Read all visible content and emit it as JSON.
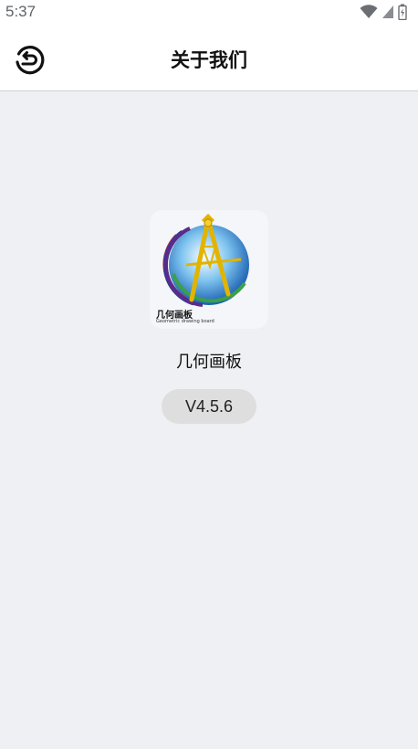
{
  "status_bar": {
    "time": "5:37",
    "icons": [
      "wifi-icon",
      "cell-signal-icon",
      "battery-icon"
    ]
  },
  "header": {
    "back_icon": "back-arrow-icon",
    "title": "关于我们"
  },
  "app": {
    "logo_text": "几何画板",
    "logo_subtext": "Geometric drawing board",
    "name": "几何画板",
    "version": "V4.5.6"
  },
  "colors": {
    "background": "#eef0f3",
    "appbar": "#ffffff",
    "version_pill": "#dedede"
  }
}
